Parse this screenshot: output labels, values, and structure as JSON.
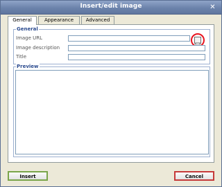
{
  "window": {
    "title": "Insert/edit image",
    "close_glyph": "✕"
  },
  "tabs": [
    {
      "label": "General",
      "active": true
    },
    {
      "label": "Appearance",
      "active": false
    },
    {
      "label": "Advanced",
      "active": false
    }
  ],
  "general_section": {
    "legend": "General",
    "fields": [
      {
        "label": "Image URL",
        "value": "",
        "placeholder": ""
      },
      {
        "label": "Image description",
        "value": "",
        "placeholder": ""
      },
      {
        "label": "Title",
        "value": "",
        "placeholder": ""
      }
    ],
    "browse_icon": "file-browser-icon",
    "highlight_color": "#e8141e"
  },
  "preview_section": {
    "legend": "Preview"
  },
  "buttons": {
    "insert_label": "Insert",
    "cancel_label": "Cancel"
  },
  "colors": {
    "titlebar": "#6c83ab",
    "legend_text": "#2b4b8f",
    "insert_border": "#7aa54a",
    "cancel_border": "#c63a3a"
  }
}
